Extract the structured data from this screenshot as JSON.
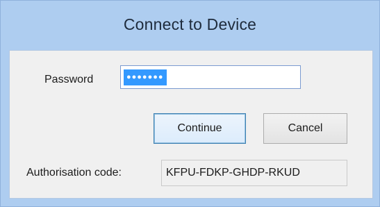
{
  "window": {
    "title": "Connect to Device"
  },
  "password": {
    "label": "Password",
    "masked_value": "●●●●●●●"
  },
  "buttons": {
    "continue_label": "Continue",
    "cancel_label": "Cancel"
  },
  "authorisation": {
    "label": "Authorisation code:",
    "value": "KFPU-FDKP-GHDP-RKUD"
  },
  "colors": {
    "frame": "#aecdf0",
    "selection": "#3399ff",
    "default_button_border": "#3c7fb1"
  }
}
